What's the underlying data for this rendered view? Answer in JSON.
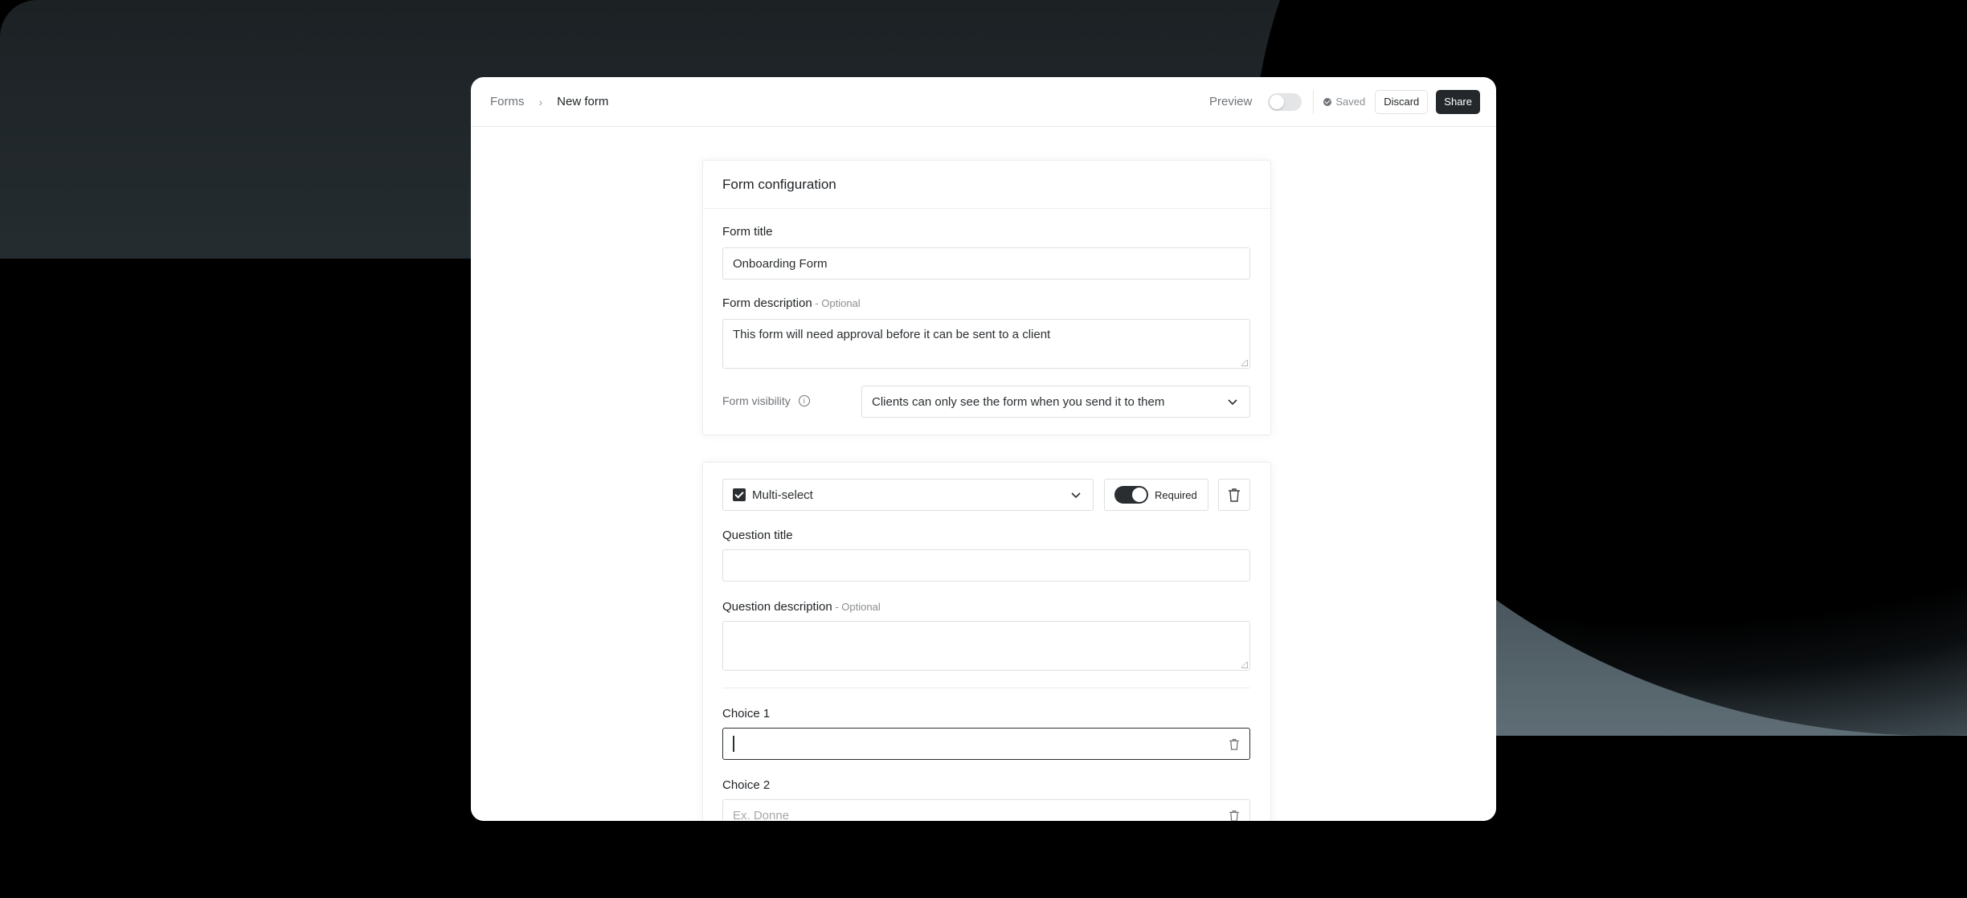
{
  "breadcrumb": {
    "root": "Forms",
    "separator": "›",
    "current": "New form"
  },
  "toolbar": {
    "preview_label": "Preview",
    "preview_enabled": false,
    "saved_label": "Saved",
    "discard_label": "Discard",
    "share_label": "Share"
  },
  "config": {
    "header": "Form configuration",
    "title_label": "Form title",
    "title_value": "Onboarding Form",
    "description_label": "Form description",
    "description_optional": " - Optional",
    "description_value": "This form will need approval before it can be sent to a client",
    "visibility_label": "Form visibility",
    "visibility_value": "Clients can only see the form when you send it to them"
  },
  "question": {
    "type_value": "Multi-select",
    "required_label": "Required",
    "required_enabled": true,
    "title_label": "Question title",
    "title_value": "",
    "description_label": "Question description",
    "description_optional": " - Optional",
    "description_value": "",
    "choices": [
      {
        "label": "Choice 1",
        "value": "",
        "placeholder": ""
      },
      {
        "label": "Choice 2",
        "value": "",
        "placeholder": "Ex. Donne"
      }
    ]
  },
  "colors": {
    "accent_dark": "#24282b",
    "border": "#dedfe0",
    "muted_text": "#6f7378"
  }
}
